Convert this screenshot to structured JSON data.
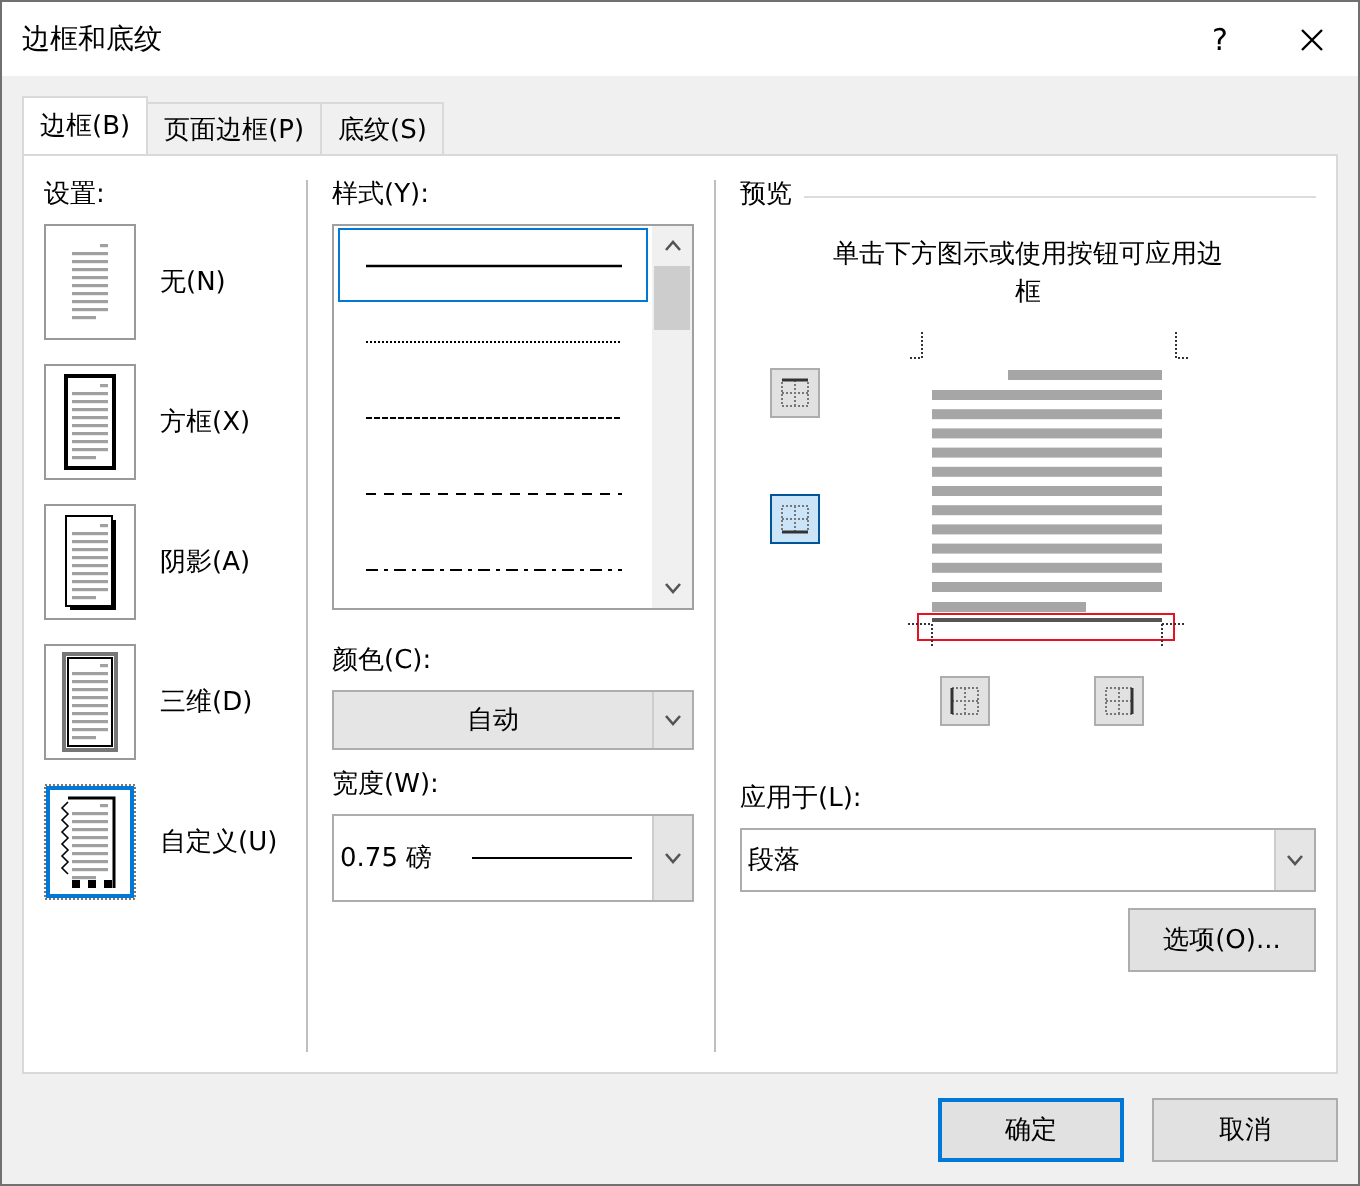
{
  "window": {
    "title": "边框和底纹",
    "help": "?"
  },
  "tabs": [
    {
      "label": "边框(B)",
      "selected": true
    },
    {
      "label": "页面边框(P)",
      "selected": false
    },
    {
      "label": "底纹(S)",
      "selected": false
    }
  ],
  "settings": {
    "label": "设置:",
    "items": [
      {
        "kind": "none",
        "label": "无(N)",
        "selected": false
      },
      {
        "kind": "box",
        "label": "方框(X)",
        "selected": false
      },
      {
        "kind": "shadow",
        "label": "阴影(A)",
        "selected": false
      },
      {
        "kind": "threed",
        "label": "三维(D)",
        "selected": false
      },
      {
        "kind": "custom",
        "label": "自定义(U)",
        "selected": true
      }
    ]
  },
  "style": {
    "label": "样式(Y):",
    "items": [
      {
        "kind": "solid",
        "selected": true
      },
      {
        "kind": "dotted",
        "selected": false
      },
      {
        "kind": "fine-dash",
        "selected": false
      },
      {
        "kind": "dash",
        "selected": false
      },
      {
        "kind": "dash-dot",
        "selected": false
      }
    ]
  },
  "color": {
    "label": "颜色(C):",
    "value": "自动"
  },
  "width": {
    "label": "宽度(W):",
    "value": "0.75 磅"
  },
  "preview": {
    "label": "预览",
    "hint": "单击下方图示或使用按钮可应用边框",
    "border_buttons": [
      {
        "kind": "top",
        "selected": false
      },
      {
        "kind": "bottom",
        "selected": true
      },
      {
        "kind": "left",
        "selected": false
      },
      {
        "kind": "right",
        "selected": false
      }
    ]
  },
  "apply": {
    "label": "应用于(L):",
    "value": "段落"
  },
  "options_button": "选项(O)...",
  "buttons": [
    "确定",
    "取消"
  ]
}
